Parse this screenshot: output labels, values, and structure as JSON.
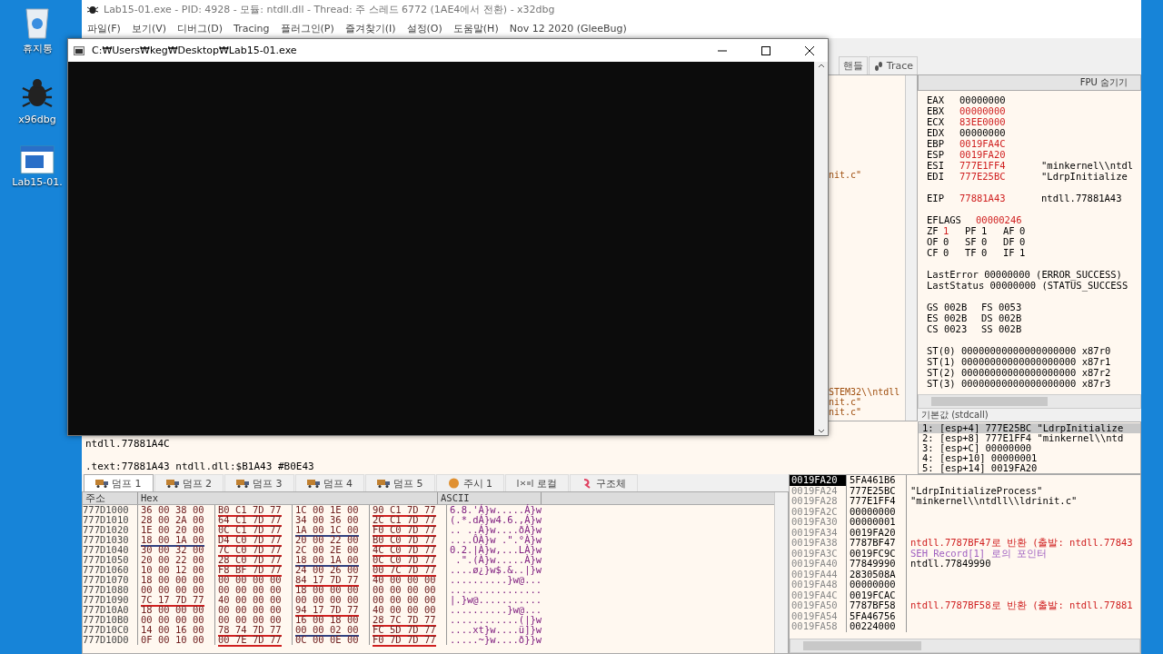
{
  "desktop": {
    "icons": [
      {
        "label": "휴지통",
        "kind": "bin"
      },
      {
        "label": "x96dbg",
        "kind": "bug"
      },
      {
        "label": "Lab15-01.",
        "kind": "app"
      }
    ]
  },
  "debugger": {
    "title": "Lab15-01.exe - PID: 4928 - 모듈: ntdll.dll - Thread: 주 스레드 6772 (1AE4에서 전환) - x32dbg",
    "menu": [
      "파일(F)",
      "보기(V)",
      "디버그(D)",
      "Tracing",
      "플러그인(P)",
      "즐겨찾기(I)",
      "설정(O)",
      "도움말(H)",
      "Nov 12 2020 (GleeBug)"
    ],
    "cpu_tabs": [
      {
        "label": "핸들",
        "kind": "handles",
        "selected": false
      },
      {
        "label": "Trace",
        "kind": "trace",
        "selected": false
      }
    ],
    "code_top": [
      "nit.c\""
    ],
    "code_bottom": [
      "STEM32\\\\ntdll",
      "nit.c\"",
      "nit.c\""
    ],
    "info_lines": [
      "ntdll.77881A4C",
      ".text:77881A43 ntdll.dll:$B1A43 #B0E43"
    ],
    "registers": {
      "header": "FPU 숨기기",
      "general": [
        {
          "name": "EAX",
          "value": "00000000",
          "changed": false
        },
        {
          "name": "EBX",
          "value": "00000000",
          "changed": true
        },
        {
          "name": "ECX",
          "value": "83EE0000",
          "changed": true
        },
        {
          "name": "EDX",
          "value": "00000000",
          "changed": false
        },
        {
          "name": "EBP",
          "value": "0019FA4C",
          "changed": true
        },
        {
          "name": "ESP",
          "value": "0019FA20",
          "changed": true
        },
        {
          "name": "ESI",
          "value": "777E1FF4",
          "changed": true,
          "comment": "\"minkernel\\\\ntdl"
        },
        {
          "name": "EDI",
          "value": "777E25BC",
          "changed": true,
          "comment": "\"LdrpInitialize"
        }
      ],
      "eip": {
        "name": "EIP",
        "value": "77881A43",
        "changed": true,
        "comment": "ntdll.77881A43"
      },
      "eflags": {
        "name": "EFLAGS",
        "value": "00000246",
        "changed": true
      },
      "flags": [
        [
          {
            "name": "ZF",
            "value": "1",
            "changed": true
          },
          {
            "name": "PF",
            "value": "1",
            "changed": false
          },
          {
            "name": "AF",
            "value": "0",
            "changed": false
          }
        ],
        [
          {
            "name": "OF",
            "value": "0",
            "changed": false
          },
          {
            "name": "SF",
            "value": "0",
            "changed": false
          },
          {
            "name": "DF",
            "value": "0",
            "changed": false
          }
        ],
        [
          {
            "name": "CF",
            "value": "0",
            "changed": false
          },
          {
            "name": "TF",
            "value": "0",
            "changed": false
          },
          {
            "name": "IF",
            "value": "1",
            "changed": false
          }
        ]
      ],
      "status": [
        "LastError  00000000 (ERROR_SUCCESS)",
        "LastStatus 00000000 (STATUS_SUCCESS"
      ],
      "segments": [
        [
          "GS 002B",
          "FS 0053"
        ],
        [
          "ES 002B",
          "DS 002B"
        ],
        [
          "CS 0023",
          "SS 002B"
        ]
      ],
      "fpu": [
        "ST(0) 00000000000000000000 x87r0",
        "ST(1) 00000000000000000000 x87r1",
        "ST(2) 00000000000000000000 x87r2",
        "ST(3) 00000000000000000000 x87r3"
      ]
    },
    "call_convention": "기본값 (stdcall)",
    "call_args": [
      {
        "text": "1: [esp+4] 777E25BC \"LdrpInitialize",
        "selected": true
      },
      {
        "text": "2: [esp+8] 777E1FF4 \"minkernel\\\\ntd",
        "selected": false
      },
      {
        "text": "3: [esp+C] 00000000",
        "selected": false
      },
      {
        "text": "4: [esp+10] 00000001",
        "selected": false
      },
      {
        "text": "5: [esp+14] 0019FA20",
        "selected": false
      }
    ],
    "dump_tabs": [
      {
        "label": "덤프 1",
        "kind": "dump",
        "selected": true
      },
      {
        "label": "덤프 2",
        "kind": "dump",
        "selected": false
      },
      {
        "label": "덤프 3",
        "kind": "dump",
        "selected": false
      },
      {
        "label": "덤프 4",
        "kind": "dump",
        "selected": false
      },
      {
        "label": "덤프 5",
        "kind": "dump",
        "selected": false
      },
      {
        "label": "주시 1",
        "kind": "watch",
        "selected": false
      },
      {
        "label": "로컬",
        "kind": "locals",
        "selected": false
      },
      {
        "label": "구조체",
        "kind": "struct",
        "selected": false
      }
    ],
    "dump_columns": [
      "주소",
      "Hex",
      "ASCII"
    ],
    "dump_rows": [
      {
        "address": "777D1000",
        "groups": [
          {
            "bytes": "36 00 38 00"
          },
          {
            "bytes": "B0 C1 7D 77",
            "color": "#d02020"
          },
          {
            "bytes": "1C 00 1E 00"
          },
          {
            "bytes": "90 C1 7D 77",
            "color": "#d02020"
          }
        ],
        "ascii": "6.8.'Á}w.....Á}w"
      },
      {
        "address": "777D1010",
        "groups": [
          {
            "bytes": "28 00 2A 00"
          },
          {
            "bytes": "64 C1 7D 77",
            "color": "#d02020"
          },
          {
            "bytes": "34 00 36 00"
          },
          {
            "bytes": "2C C1 7D 77",
            "color": "#d02020"
          }
        ],
        "ascii": "(.*.dÁ}w4.6.,Á}w"
      },
      {
        "address": "777D1020",
        "groups": [
          {
            "bytes": "1E 00 20 00"
          },
          {
            "bytes": "0C C1 7D 77",
            "color": "#d02020"
          },
          {
            "bytes": "1A 00 1C 00",
            "color": "#304080"
          },
          {
            "bytes": "F0 C0 7D 77",
            "color": "#d02020"
          }
        ],
        "ascii": ".. ..Á}w....ðÀ}w"
      },
      {
        "address": "777D1030",
        "groups": [
          {
            "bytes": "18 00 1A 00",
            "color": "#304080"
          },
          {
            "bytes": "D4 C0 7D 77",
            "color": "#d02020"
          },
          {
            "bytes": "20 00 22 00"
          },
          {
            "bytes": "B0 C0 7D 77",
            "color": "#d02020"
          }
        ],
        "ascii": "....ÔÀ}w .\".°À}w"
      },
      {
        "address": "777D1040",
        "groups": [
          {
            "bytes": "30 00 32 00"
          },
          {
            "bytes": "7C C0 7D 77",
            "color": "#d02020"
          },
          {
            "bytes": "2C 00 2E 00"
          },
          {
            "bytes": "4C C0 7D 77",
            "color": "#d02020"
          }
        ],
        "ascii": "0.2.|À}w,...LÀ}w"
      },
      {
        "address": "777D1050",
        "groups": [
          {
            "bytes": "20 00 22 00"
          },
          {
            "bytes": "28 C0 7D 77",
            "color": "#d02020"
          },
          {
            "bytes": "18 00 1A 00",
            "color": "#304080"
          },
          {
            "bytes": "0C C0 7D 77",
            "color": "#d02020"
          }
        ],
        "ascii": " .\".(À}w.....À}w"
      },
      {
        "address": "777D1060",
        "groups": [
          {
            "bytes": "10 00 12 00"
          },
          {
            "bytes": "F8 BF 7D 77",
            "color": "#d02020"
          },
          {
            "bytes": "24 00 26 00"
          },
          {
            "bytes": "00 7C 7D 77",
            "color": "#d02020"
          }
        ],
        "ascii": "....ø¿}w$.&..|}w"
      },
      {
        "address": "777D1070",
        "groups": [
          {
            "bytes": "18 00 00 00"
          },
          {
            "bytes": "00 00 00 00"
          },
          {
            "bytes": "84 17 7D 77",
            "color": "#d02020"
          },
          {
            "bytes": "40 00 00 00"
          }
        ],
        "ascii": "..........}w@..."
      },
      {
        "address": "777D1080",
        "groups": [
          {
            "bytes": "00 00 00 00"
          },
          {
            "bytes": "00 00 00 00"
          },
          {
            "bytes": "18 00 00 00"
          },
          {
            "bytes": "00 00 00 00"
          }
        ],
        "ascii": "................"
      },
      {
        "address": "777D1090",
        "groups": [
          {
            "bytes": "7C 17 7D 77",
            "color": "#d02020"
          },
          {
            "bytes": "40 00 00 00"
          },
          {
            "bytes": "00 00 00 00"
          },
          {
            "bytes": "00 00 00 00"
          }
        ],
        "ascii": "|.}w@..........."
      },
      {
        "address": "777D10A0",
        "groups": [
          {
            "bytes": "18 00 00 00"
          },
          {
            "bytes": "00 00 00 00"
          },
          {
            "bytes": "94 17 7D 77",
            "color": "#d02020"
          },
          {
            "bytes": "40 00 00 00"
          }
        ],
        "ascii": "..........}w@..."
      },
      {
        "address": "777D10B0",
        "groups": [
          {
            "bytes": "00 00 00 00"
          },
          {
            "bytes": "00 00 00 00"
          },
          {
            "bytes": "16 00 18 00"
          },
          {
            "bytes": "28 7C 7D 77",
            "color": "#d02020"
          }
        ],
        "ascii": "............(|}w"
      },
      {
        "address": "777D10C0",
        "groups": [
          {
            "bytes": "14 00 16 00"
          },
          {
            "bytes": "78 74 7D 77",
            "color": "#d02020"
          },
          {
            "bytes": "00 00 02 00",
            "color": "#304080"
          },
          {
            "bytes": "FC 5D 7D 77",
            "color": "#d02020"
          }
        ],
        "ascii": "....xt}w....ü]}w"
      },
      {
        "address": "777D10D0",
        "groups": [
          {
            "bytes": "0F 00 10 00"
          },
          {
            "bytes": "00 7E 7D 77",
            "color": "#d02020"
          },
          {
            "bytes": "0C 00 0E 00"
          },
          {
            "bytes": "F0 7D 7D 77",
            "color": "#d02020"
          }
        ],
        "ascii": ".....~}w....ð}}w"
      }
    ],
    "stack_rows": [
      {
        "address": "0019FA20",
        "value": "5FA461B6",
        "selected": true
      },
      {
        "address": "0019FA24",
        "value": "777E25BC",
        "selected": false,
        "comment": "\"LdrpInitializeProcess\"",
        "kind": "string"
      },
      {
        "address": "0019FA28",
        "value": "777E1FF4",
        "selected": false,
        "comment": "\"minkernel\\\\ntdll\\\\ldrinit.c\"",
        "kind": "string"
      },
      {
        "address": "0019FA2C",
        "value": "00000000",
        "selected": false
      },
      {
        "address": "0019FA30",
        "value": "00000001",
        "selected": false
      },
      {
        "address": "0019FA34",
        "value": "0019FA20",
        "selected": false
      },
      {
        "address": "0019FA38",
        "value": "7787BF47",
        "selected": false,
        "comment": "ntdll.7787BF47로 반환 (출발: ntdll.77843",
        "kind": "return"
      },
      {
        "address": "0019FA3C",
        "value": "0019FC9C",
        "selected": false,
        "comment": "SEH_Record[1] 로의 포인터",
        "kind": "seh"
      },
      {
        "address": "0019FA40",
        "value": "77849990",
        "selected": false,
        "comment": "ntdll.77849990",
        "kind": "plain"
      },
      {
        "address": "0019FA44",
        "value": "2830508A",
        "selected": false
      },
      {
        "address": "0019FA48",
        "value": "00000000",
        "selected": false
      },
      {
        "address": "0019FA4C",
        "value": "0019FCAC",
        "selected": false
      },
      {
        "address": "0019FA50",
        "value": "7787BF58",
        "selected": false,
        "comment": "ntdll.7787BF58로 반환 (출발: ntdll.77881",
        "kind": "return"
      },
      {
        "address": "0019FA54",
        "value": "5FA46756",
        "selected": false
      },
      {
        "address": "0019FA58",
        "value": "00224000",
        "selected": false
      }
    ]
  },
  "console": {
    "title": "C:₩Users₩keg₩Desktop₩Lab15-01.exe"
  }
}
